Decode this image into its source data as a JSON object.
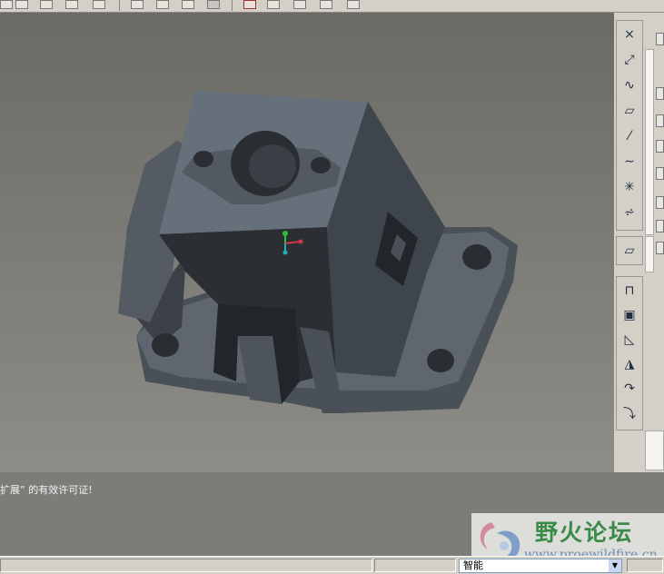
{
  "top_toolbar": {
    "icons": [
      "view-icon",
      "search-view-icon",
      "orient-icon",
      "display-style-icon",
      "layer-icon",
      "saved-view-1-icon",
      "saved-view-2-icon",
      "saved-view-3-icon",
      "saved-view-4-icon",
      "datum-plane-display-icon",
      "datum-axis-display-icon",
      "datum-point-display-icon",
      "csys-display-icon"
    ]
  },
  "viewport": {
    "model_color": "#5f6570",
    "background_top": "#6b6a65",
    "background_bottom": "#8d8c86",
    "csys_colors": [
      "#2dbf3a",
      "#d2354a",
      "#20b0b8"
    ]
  },
  "right_toolbar": {
    "group1": [
      "datum-point-icon",
      "datum-curve-sketch-icon",
      "datum-curve-icon",
      "datum-plane-icon",
      "datum-axis-icon",
      "curve-icon",
      "csys-icon",
      "analysis-icon"
    ],
    "group2": [
      "sketch-icon"
    ],
    "group3": [
      "extrude-icon",
      "revolve-icon",
      "sweep-icon",
      "blend-icon",
      "hole-icon",
      "round-icon"
    ]
  },
  "message": {
    "text": "扩展” 的有效许可证!"
  },
  "status_bar": {
    "filter_value": "智能"
  },
  "watermark": {
    "title": "野火论坛",
    "url": "www.proewildfire.cn"
  }
}
